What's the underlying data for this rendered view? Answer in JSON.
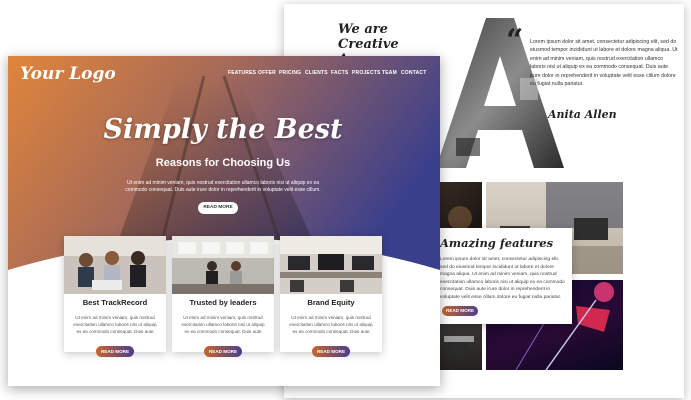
{
  "back_page": {
    "agency_title_line1": "We are",
    "agency_title_line2": "Creative Agency",
    "quote_mark": "“",
    "quote_text": "Lorem ipsum dolor sit amet, consectetur adipiscing elit, sed do eiusmod tempor incididunt ut labore et dolore magna aliqua. Ut enim ad minim veniam, quis nostrud exercitation ullamco laboris nisi ut aliquip ex ea commodo consequat. Duis aute irure dolor in reprehenderit in voluptate velit esse cillum dolore eu fugiat nulla pariatur.",
    "signature": "Anita Allen",
    "features": {
      "title": "Amazing features",
      "text": "Lorem ipsum dolor sit amet, consectetur adipiscing elit, sed do eiusmod tempor incididunt ut labore et dolore magna aliqua. Ut enim ad minim veniam, quis nostrud exercitation ullamco laboris nisi ut aliquip ex ea commodo consequat. Duis aute irure dolor in reprehenderit in voluptate velit esse cillum dolore eu fugiat nulla pariatur.",
      "button": "READ MORE"
    }
  },
  "front_page": {
    "logo": "Your Logo",
    "nav": [
      "FEATURES",
      "OFFER",
      "PRICING",
      "CLIENTS",
      "FACTS",
      "PROJECTS",
      "TEAM",
      "CONTACT"
    ],
    "hero": {
      "title": "Simply the Best",
      "subtitle": "Reasons for Choosing Us",
      "text": "Ut enim ad minim veniam, quis nostrud exercitation ullamco laboris nisi ut aliquip ex ea commodo consequat. Duis aute irure dolor in reprehenderit in voluptate velit esse cillum.",
      "button": "READ MORE"
    },
    "cards": [
      {
        "title": "Best TrackRecord",
        "text": "Ut enim ad minim veniam, quis nostrud exercitation ullamco laboris nisi ut aliquip ex ea commodo consequat. Duis aute",
        "button": "READ MORE"
      },
      {
        "title": "Trusted by leaders",
        "text": "Ut enim ad minim veniam, quis nostrud exercitation ullamco laboris nisi ut aliquip ex ea commodo consequat. Duis aute",
        "button": "READ MORE"
      },
      {
        "title": "Brand Equity",
        "text": "Ut enim ad minim veniam, quis nostrud exercitation ullamco laboris nisi ut aliquip ex ea commodo consequat. Duis aute",
        "button": "READ MORE"
      }
    ]
  },
  "colors": {
    "accent_orange": "#c8662a",
    "accent_purple": "#4b3d8f"
  }
}
